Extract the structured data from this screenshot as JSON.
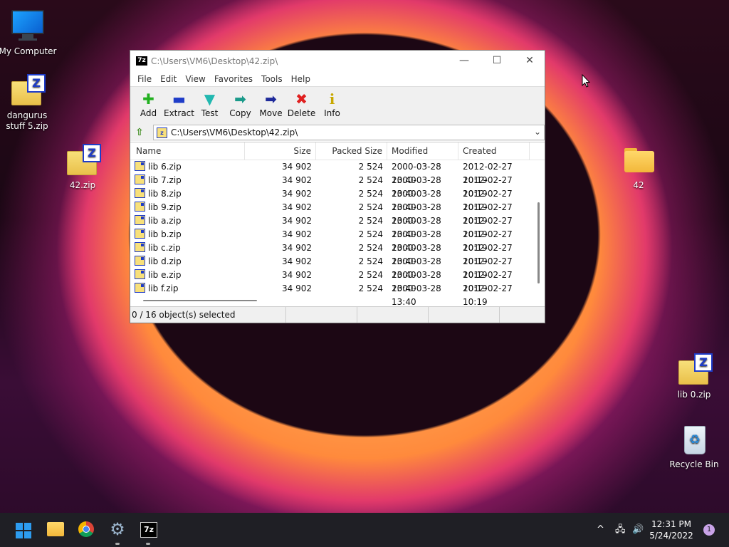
{
  "desktop": {
    "icons": [
      {
        "label": "My Computer"
      },
      {
        "label": "dangurus stuff 5.zip"
      },
      {
        "label": "42.zip"
      },
      {
        "label": "42"
      },
      {
        "label": "lib 0.zip"
      },
      {
        "label": "Recycle Bin"
      }
    ]
  },
  "window": {
    "app_icon": "7z",
    "title": "C:\\Users\\VM6\\Desktop\\42.zip\\",
    "minimize": "—",
    "maximize": "☐",
    "close": "✕",
    "menu": [
      "File",
      "Edit",
      "View",
      "Favorites",
      "Tools",
      "Help"
    ],
    "toolbar": [
      {
        "label": "Add",
        "glyph": "✚",
        "color": "#22b020"
      },
      {
        "label": "Extract",
        "glyph": "▬",
        "color": "#1e3cc8"
      },
      {
        "label": "Test",
        "glyph": "▼",
        "color": "#22b8b0"
      },
      {
        "label": "Copy",
        "glyph": "➡",
        "color": "#1a9a8a"
      },
      {
        "label": "Move",
        "glyph": "➡",
        "color": "#1e2a9a"
      },
      {
        "label": "Delete",
        "glyph": "✖",
        "color": "#e02020"
      },
      {
        "label": "Info",
        "glyph": "i",
        "color": "#c8a800"
      }
    ],
    "address": "C:\\Users\\VM6\\Desktop\\42.zip\\",
    "columns": [
      "Name",
      "Size",
      "Packed Size",
      "Modified",
      "Created"
    ],
    "rows": [
      [
        "lib 6.zip",
        "34 902",
        "2 524",
        "2000-03-28 13:40",
        "2012-02-27 10:19"
      ],
      [
        "lib 7.zip",
        "34 902",
        "2 524",
        "2000-03-28 13:40",
        "2012-02-27 10:19"
      ],
      [
        "lib 8.zip",
        "34 902",
        "2 524",
        "2000-03-28 13:40",
        "2012-02-27 10:19"
      ],
      [
        "lib 9.zip",
        "34 902",
        "2 524",
        "2000-03-28 13:40",
        "2012-02-27 10:19"
      ],
      [
        "lib a.zip",
        "34 902",
        "2 524",
        "2000-03-28 13:40",
        "2012-02-27 10:19"
      ],
      [
        "lib b.zip",
        "34 902",
        "2 524",
        "2000-03-28 13:40",
        "2012-02-27 10:19"
      ],
      [
        "lib c.zip",
        "34 902",
        "2 524",
        "2000-03-28 13:40",
        "2012-02-27 10:19"
      ],
      [
        "lib d.zip",
        "34 902",
        "2 524",
        "2000-03-28 13:40",
        "2012-02-27 10:19"
      ],
      [
        "lib e.zip",
        "34 902",
        "2 524",
        "2000-03-28 13:40",
        "2012-02-27 10:19"
      ],
      [
        "lib f.zip",
        "34 902",
        "2 524",
        "2000-03-28 13:40",
        "2012-02-27 10:19"
      ]
    ],
    "status": "0 / 16 object(s) selected"
  },
  "taskbar": {
    "time": "12:31 PM",
    "date": "5/24/2022",
    "notification_count": "1",
    "tray_chevron": "^",
    "tray_network": "🖧",
    "tray_volume": "🔊"
  }
}
